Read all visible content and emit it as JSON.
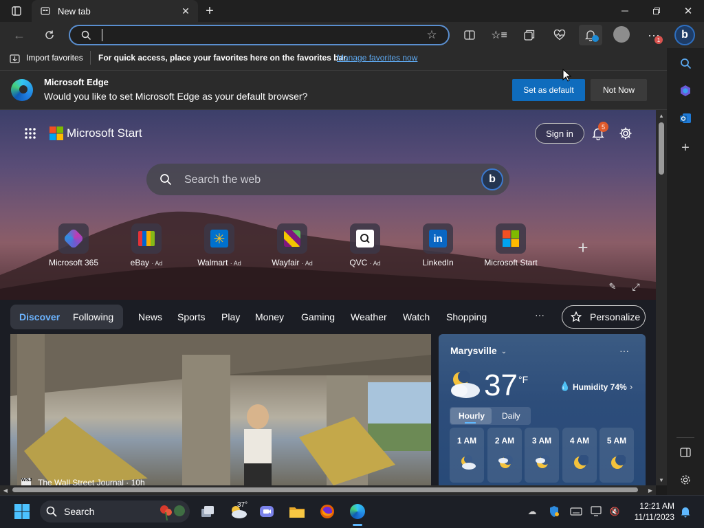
{
  "tab": {
    "title": "New tab"
  },
  "favorites_bar": {
    "import_label": "Import favorites",
    "hint": "For quick access, place your favorites here on the favorites bar.",
    "manage_link": "Manage favorites now"
  },
  "default_banner": {
    "app_name": "Microsoft Edge",
    "question": "Would you like to set Microsoft Edge as your default browser?",
    "set_default": "Set as default",
    "not_now": "Not Now"
  },
  "toolbar": {
    "notification_badge": "1"
  },
  "start": {
    "brand": "Microsoft Start",
    "sign_in": "Sign in",
    "notification_count": "5",
    "search_placeholder": "Search the web"
  },
  "quick_links": [
    {
      "label": "Microsoft 365",
      "ad": ""
    },
    {
      "label": "eBay",
      "ad": "· Ad"
    },
    {
      "label": "Walmart",
      "ad": "· Ad"
    },
    {
      "label": "Wayfair",
      "ad": "· Ad"
    },
    {
      "label": "QVC",
      "ad": "· Ad"
    },
    {
      "label": "LinkedIn",
      "ad": ""
    },
    {
      "label": "Microsoft Start",
      "ad": ""
    }
  ],
  "feed_tabs": [
    "Discover",
    "Following",
    "News",
    "Sports",
    "Play",
    "Money",
    "Gaming",
    "Weather",
    "Watch",
    "Shopping"
  ],
  "more_label": "···",
  "personalize": "Personalize",
  "article": {
    "source": "The Wall Street Journal · 10h"
  },
  "weather": {
    "location": "Marysville",
    "temp": "37",
    "unit": "°F",
    "humidity": "Humidity 74%",
    "tabs": [
      "Hourly",
      "Daily"
    ],
    "hours": [
      "1 AM",
      "2 AM",
      "3 AM",
      "4 AM",
      "5 AM"
    ],
    "hour_icons": [
      "partly-cloudy-night",
      "partly-cloudy-night",
      "partly-cloudy-night",
      "clear-night",
      "clear-night"
    ]
  },
  "taskbar": {
    "search": "Search",
    "weather_temp": "37°",
    "time": "12:21 AM",
    "date": "11/11/2023"
  },
  "colors": {
    "accent": "#0f6cbd",
    "link": "#5ea9f0",
    "badge": "#e05a2b"
  }
}
